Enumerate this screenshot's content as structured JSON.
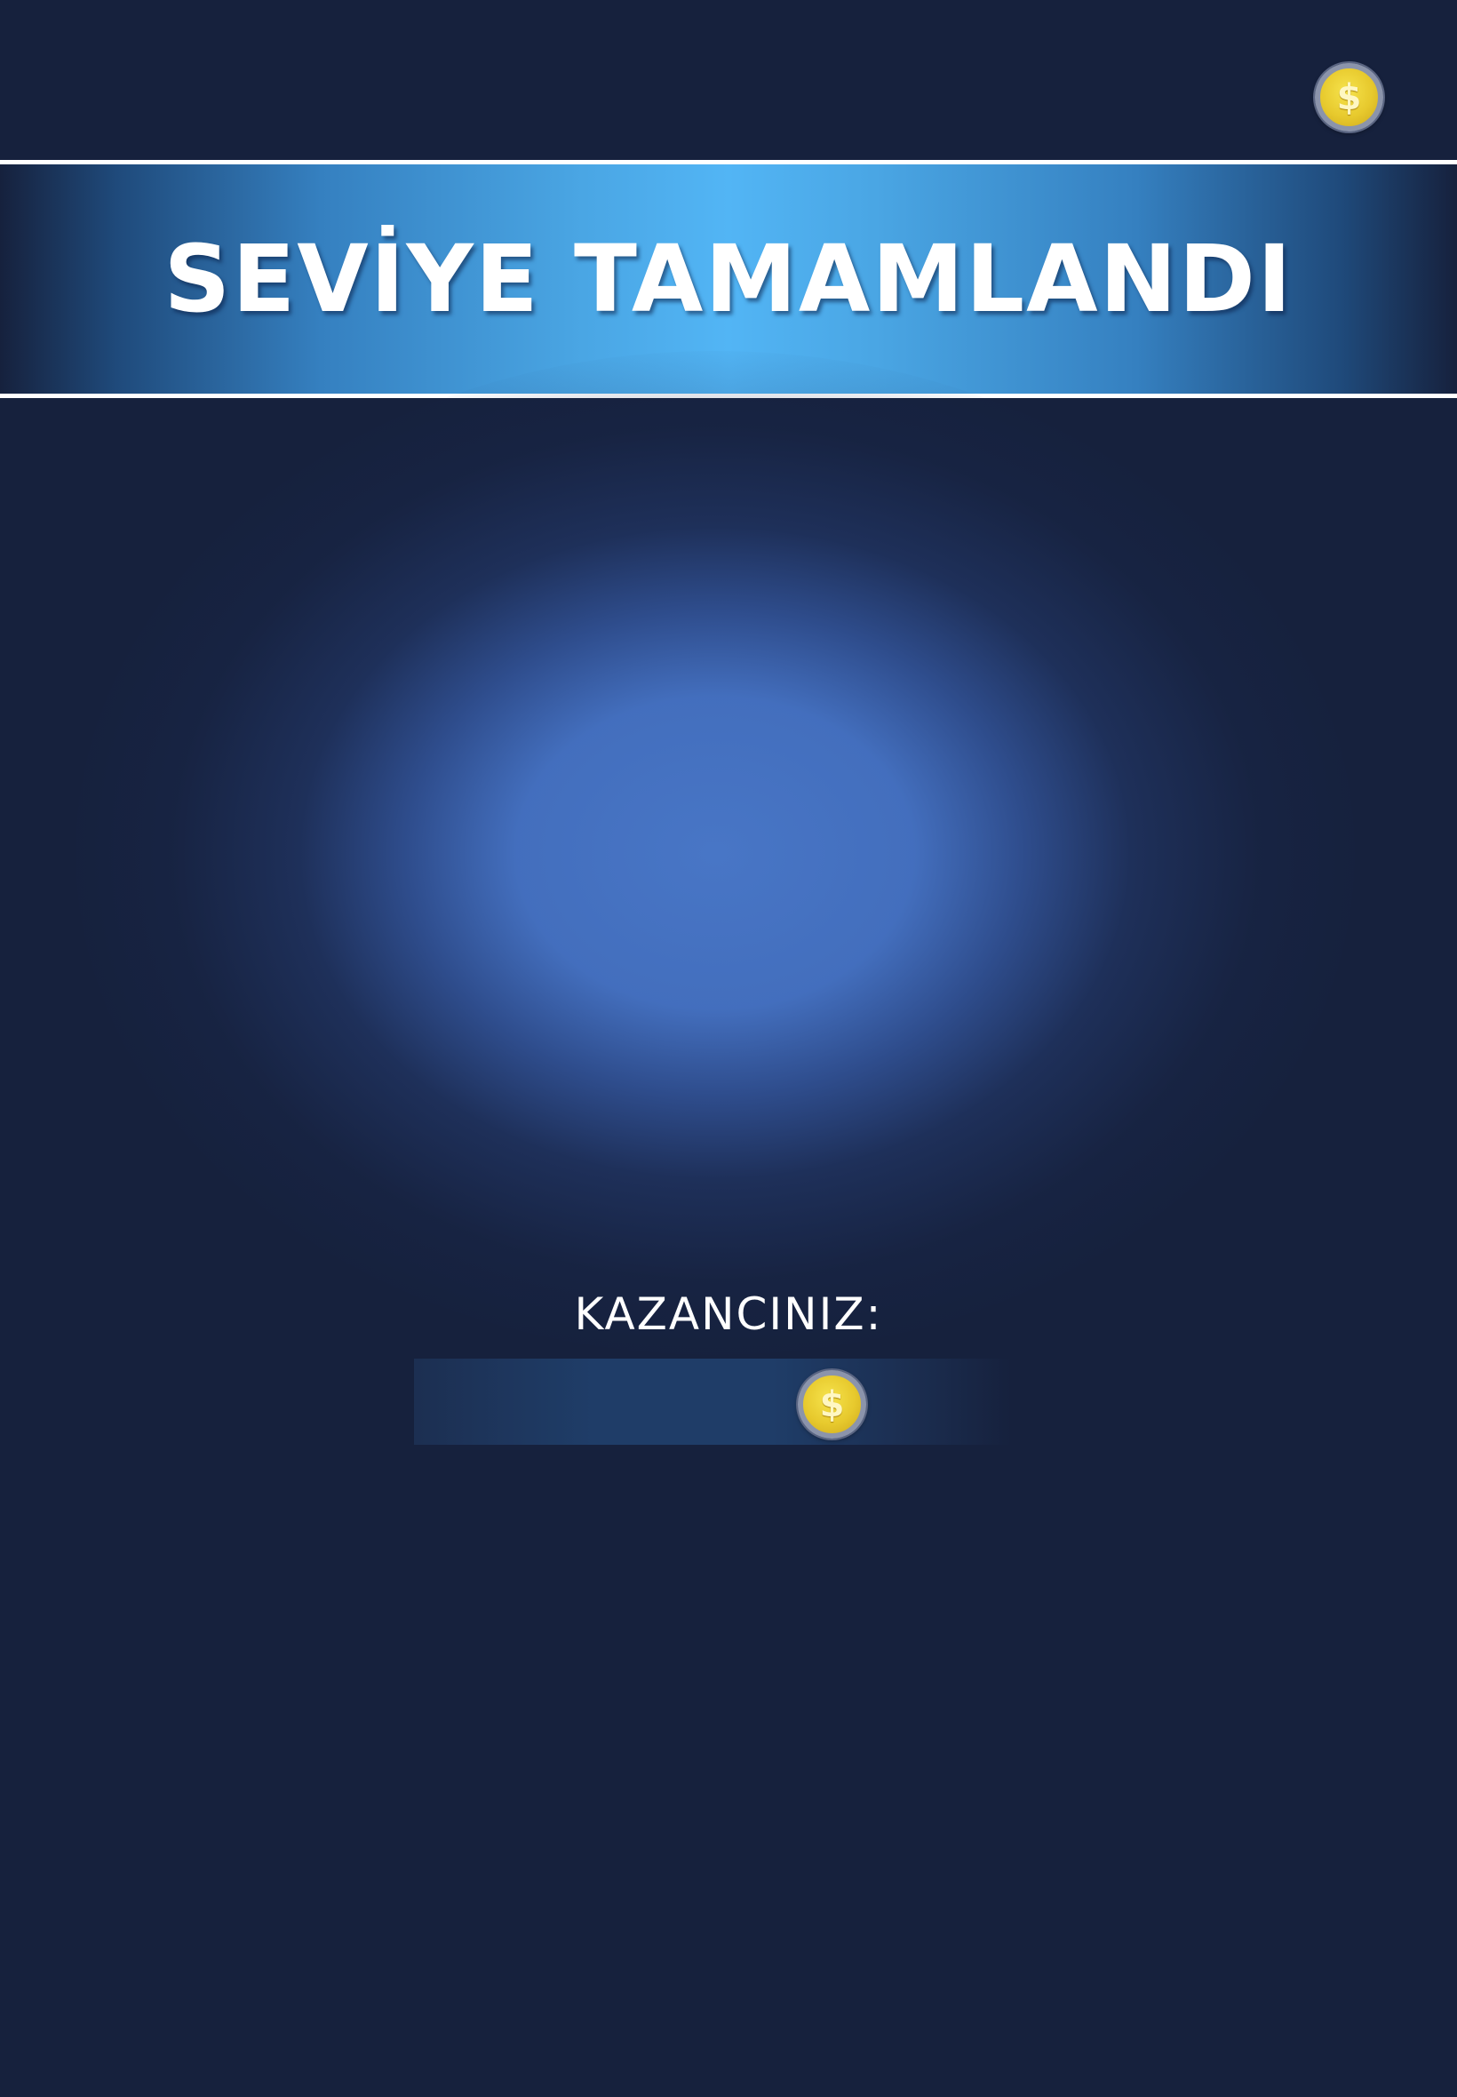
{
  "header": {
    "coin_icon": "coin-icon",
    "coin_symbol": "$"
  },
  "banner": {
    "title": "SEVİYE TAMAMLANDI"
  },
  "reward": {
    "label": "KAZANCINIZ:",
    "coin_icon": "coin-icon",
    "coin_symbol": "$"
  },
  "colors": {
    "background": "#16213d",
    "banner_center": "#52b5f5",
    "glow": "#4876c6",
    "coin_gold": "#e7c92d",
    "text": "#ffffff"
  }
}
